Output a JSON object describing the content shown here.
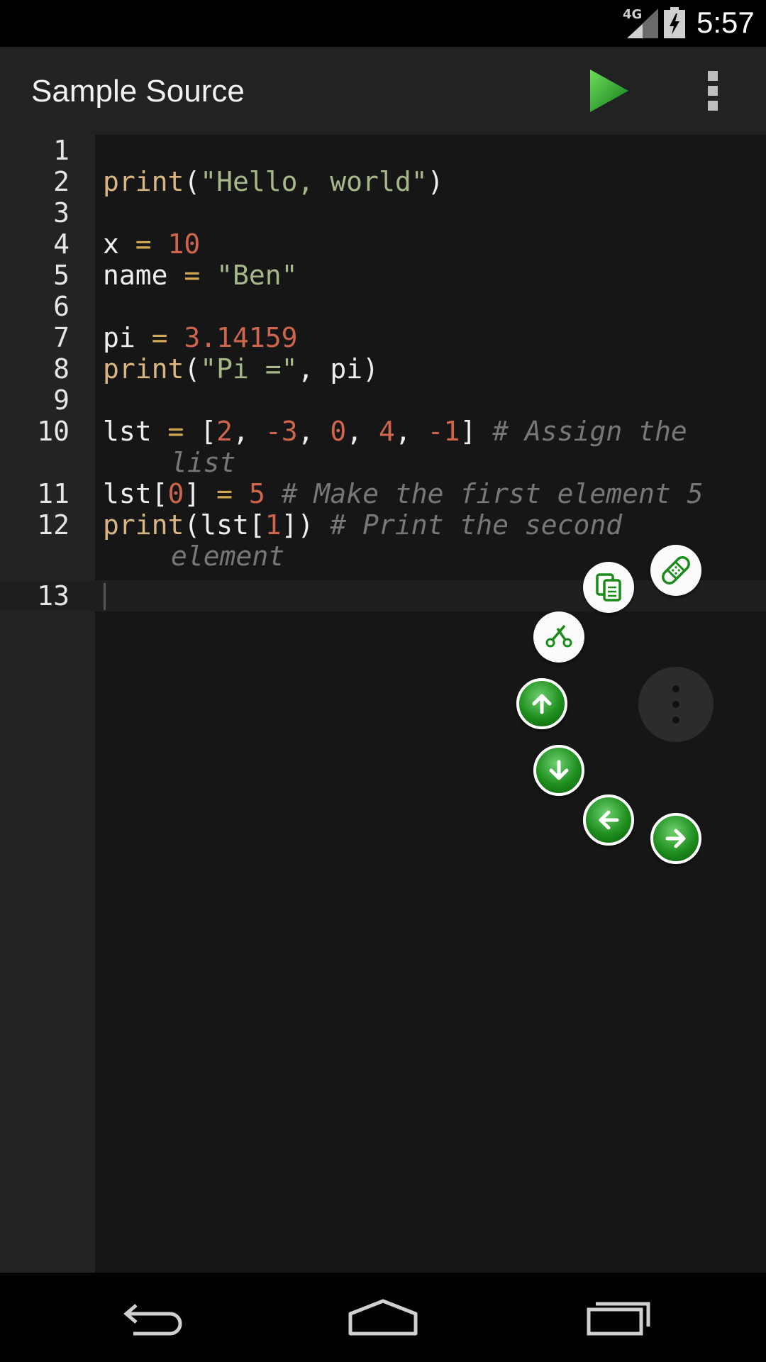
{
  "status": {
    "network": "4G",
    "time": "5:57"
  },
  "app": {
    "title": "Sample Source"
  },
  "icons": {
    "run": "play-icon",
    "overflow": "more-vert-icon",
    "paste": "bandage-icon",
    "copy": "copy-icon",
    "cut": "scissors-icon",
    "up": "arrow-up-icon",
    "down": "arrow-down-icon",
    "left": "arrow-left-icon",
    "right": "arrow-right-icon",
    "menu": "more-vert-icon"
  },
  "colors": {
    "accent_green": "#1e8e1e",
    "keyword": "#d8b581",
    "string": "#a6b889",
    "number": "#d0654e",
    "operator": "#cfa84f",
    "comment": "#777777"
  },
  "editor": {
    "lines": [
      {
        "n": "1"
      },
      {
        "n": "2"
      },
      {
        "n": "3"
      },
      {
        "n": "4"
      },
      {
        "n": "5"
      },
      {
        "n": "6"
      },
      {
        "n": "7"
      },
      {
        "n": "8"
      },
      {
        "n": "9"
      },
      {
        "n": "10"
      },
      {
        "n": "11"
      },
      {
        "n": "12"
      },
      {
        "n": "13"
      }
    ],
    "code": {
      "l2": {
        "fn": "print",
        "p1": "(",
        "s": "\"Hello, world\"",
        "p2": ")"
      },
      "l4": {
        "v": "x ",
        "eq": "=",
        "num": " 10"
      },
      "l5": {
        "v": "name ",
        "eq": "=",
        "s": " \"Ben\""
      },
      "l7": {
        "v": "pi ",
        "eq": "=",
        "num": " 3.14159"
      },
      "l8": {
        "fn": "print",
        "p1": "(",
        "s": "\"Pi =\"",
        "rest": ", pi)"
      },
      "l10": {
        "v": "lst ",
        "eq": "=",
        "a": " [",
        "n1": "2",
        "c1": ", ",
        "n2": "-3",
        "c2": ", ",
        "n3": "0",
        "c3": ", ",
        "n4": "4",
        "c4": ", ",
        "n5": "-1",
        "b": "] ",
        "cm": "# Assign the",
        "wrap": "list"
      },
      "l11": {
        "v": "lst[",
        "n": "0",
        "b": "] ",
        "eq": "=",
        "num": " 5",
        "cm": " # Make the first element 5"
      },
      "l12": {
        "fn": "print",
        "a": "(lst[",
        "n": "1",
        "b": "]) ",
        "cm": "# Print the second",
        "wrap": "element"
      }
    }
  }
}
